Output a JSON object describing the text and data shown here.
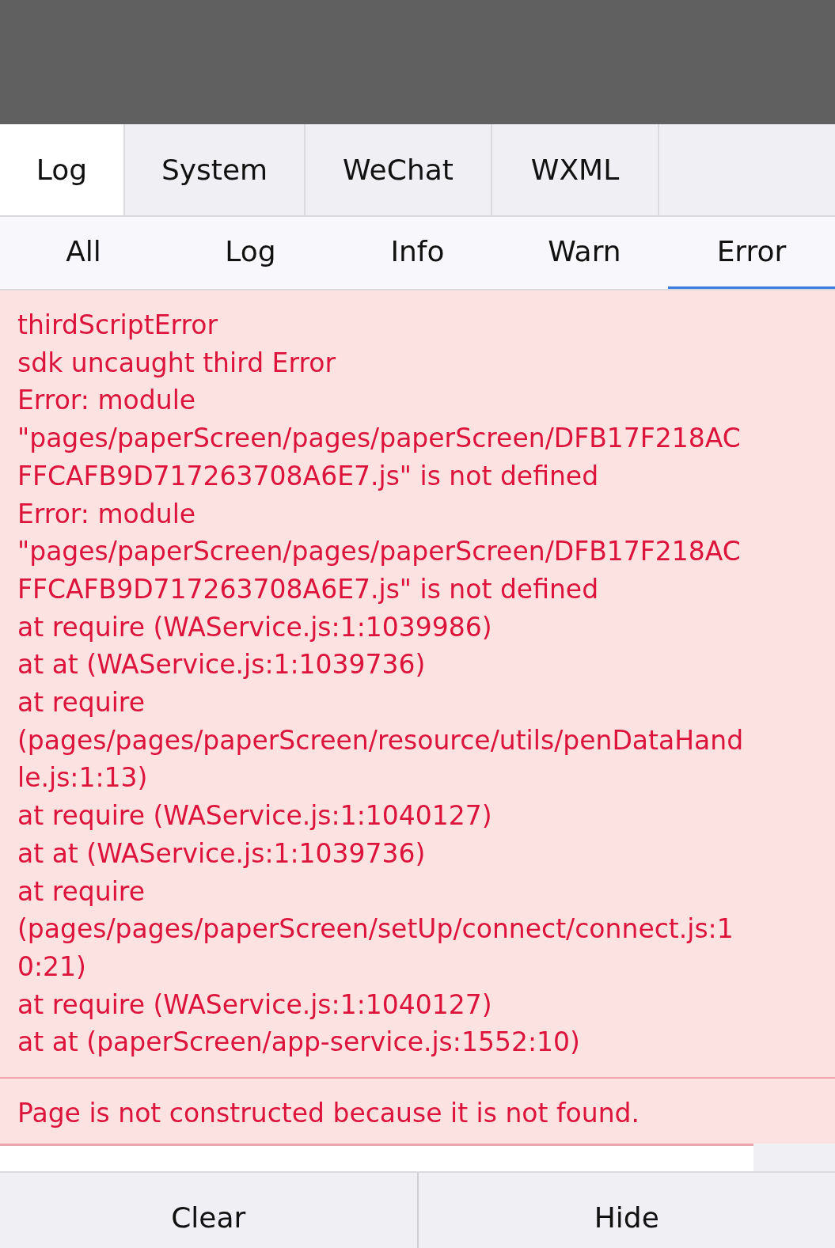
{
  "tabs": [
    {
      "label": "Log",
      "selected": true
    },
    {
      "label": "System",
      "selected": false
    },
    {
      "label": "WeChat",
      "selected": false
    },
    {
      "label": "WXML",
      "selected": false
    }
  ],
  "filters": [
    {
      "label": "All",
      "selected": false
    },
    {
      "label": "Log",
      "selected": false
    },
    {
      "label": "Info",
      "selected": false
    },
    {
      "label": "Warn",
      "selected": false
    },
    {
      "label": "Error",
      "selected": true
    }
  ],
  "log_entries": [
    {
      "kind": "error",
      "lines": [
        "thirdScriptError",
        "sdk uncaught third Error",
        "Error: module",
        "\"pages/paperScreen/pages/paperScreen/DFB17F218AC",
        "FFCAFB9D717263708A6E7.js\" is not defined",
        "Error: module",
        "\"pages/paperScreen/pages/paperScreen/DFB17F218AC",
        "FFCAFB9D717263708A6E7.js\" is not defined",
        "at require (WAService.js:1:1039986)",
        "at at (WAService.js:1:1039736)",
        "at require",
        "(pages/pages/paperScreen/resource/utils/penDataHand",
        "le.js:1:13)",
        "at require (WAService.js:1:1040127)",
        "at at (WAService.js:1:1039736)",
        "at require",
        "(pages/pages/paperScreen/setUp/connect/connect.js:1",
        "0:21)",
        "at require (WAService.js:1:1040127)",
        "at at (paperScreen/app-service.js:1552:10)"
      ]
    },
    {
      "kind": "error",
      "lines": [
        "Page is not constructed because it is not found."
      ]
    }
  ],
  "buttons": [
    "Clear",
    "Hide"
  ]
}
